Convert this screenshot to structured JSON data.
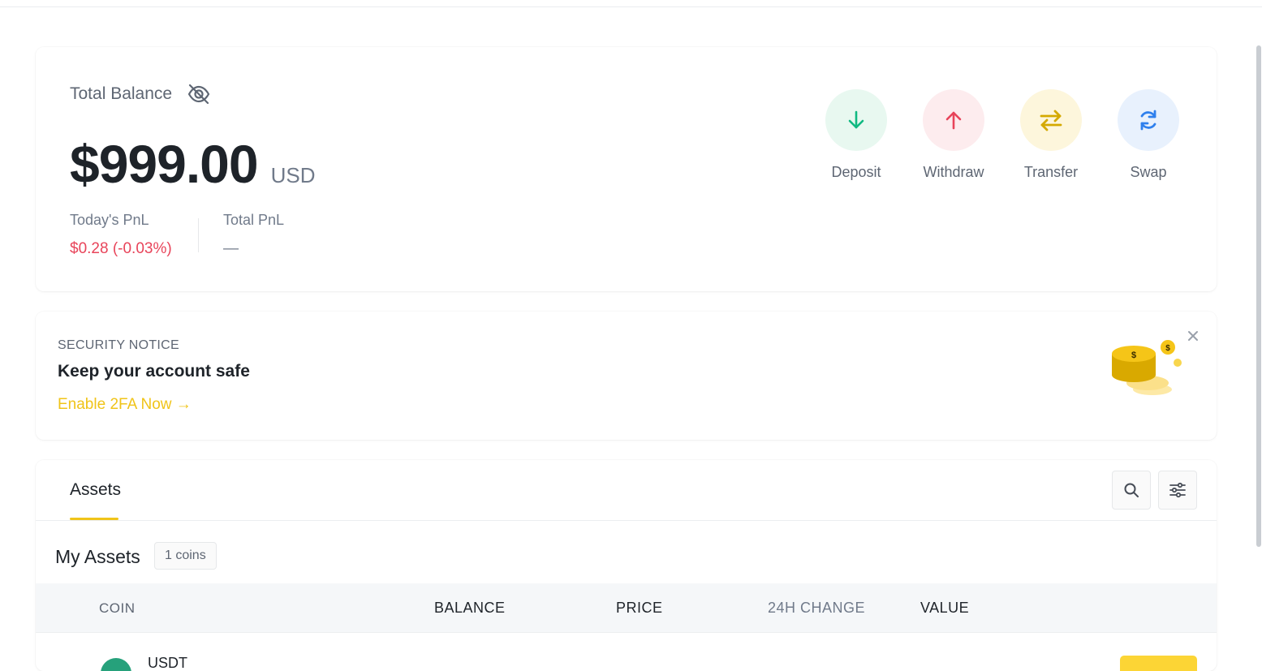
{
  "balance": {
    "title": "Total Balance",
    "amount": "$999.00",
    "currency": "USD",
    "todays_pnl_label": "Today's PnL",
    "todays_pnl_value": "$0.28 (-0.03%)",
    "total_pnl_label": "Total PnL",
    "total_pnl_value": "—"
  },
  "actions": [
    {
      "label": "Deposit",
      "icon": "arrow-down-icon",
      "color": "#10b981",
      "bg": "#e8f8f0"
    },
    {
      "label": "Withdraw",
      "icon": "arrow-up-icon",
      "color": "#e8445a",
      "bg": "#fdecee"
    },
    {
      "label": "Transfer",
      "icon": "transfer-arrows-icon",
      "color": "#d4a900",
      "bg": "#fdf6dc"
    },
    {
      "label": "Swap",
      "icon": "refresh-icon",
      "color": "#2f80ed",
      "bg": "#e8f1fd"
    }
  ],
  "notice": {
    "kicker": "SECURITY NOTICE",
    "title": "Keep your account safe",
    "link": "Enable 2FA Now →"
  },
  "assets": {
    "tab_label": "Assets",
    "section_title": "My Assets",
    "count_badge": "1 coins",
    "columns": [
      "COIN",
      "BALANCE",
      "PRICE",
      "24H CHANGE",
      "VALUE"
    ],
    "rows": [
      {
        "coin": "USDT"
      }
    ]
  },
  "colors": {
    "accent": "#f0c419",
    "negative": "#e8445a",
    "usdt": "#26a17b"
  }
}
